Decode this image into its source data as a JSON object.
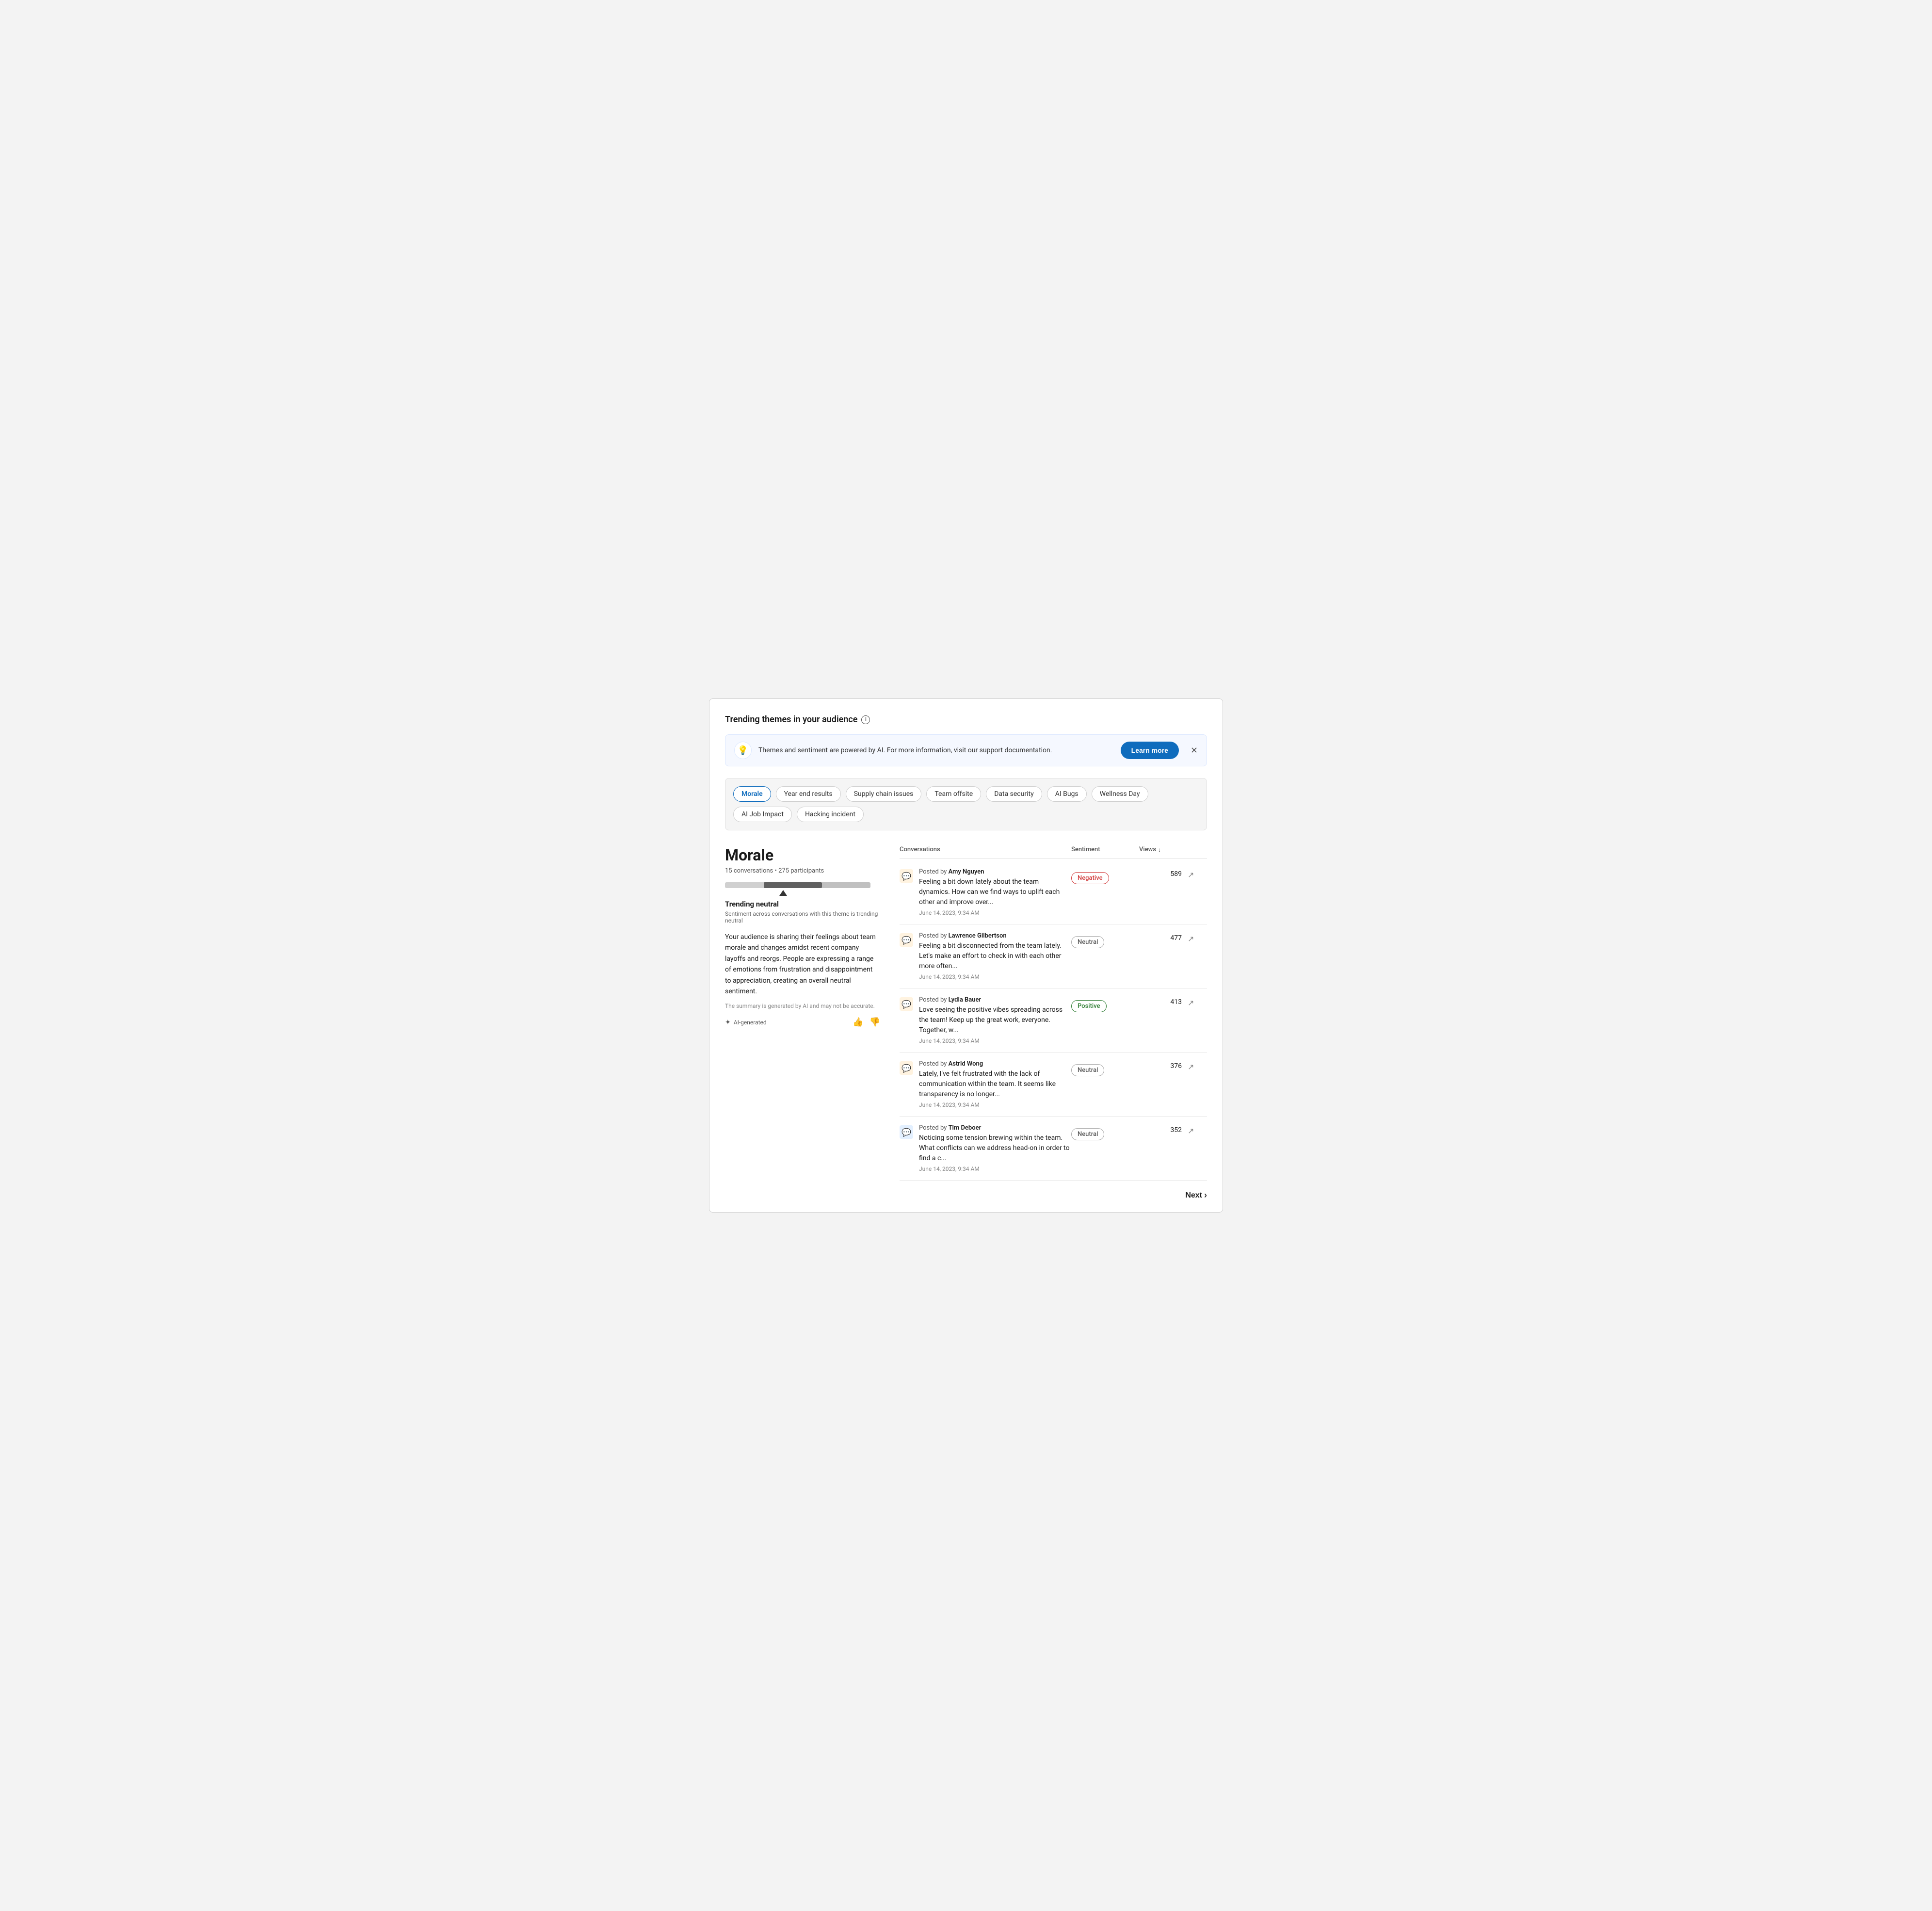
{
  "page": {
    "title": "Trending themes in your audience",
    "banner": {
      "text": "Themes and sentiment are powered by AI. For more information, visit our support documentation.",
      "learn_more": "Learn more",
      "icon": "💡"
    },
    "themes": [
      {
        "label": "Morale",
        "active": true
      },
      {
        "label": "Year end results",
        "active": false
      },
      {
        "label": "Supply chain issues",
        "active": false
      },
      {
        "label": "Team offsite",
        "active": false
      },
      {
        "label": "Data security",
        "active": false
      },
      {
        "label": "AI Bugs",
        "active": false
      },
      {
        "label": "Wellness Day",
        "active": false
      },
      {
        "label": "AI Job Impact",
        "active": false
      },
      {
        "label": "Hacking incident",
        "active": false
      }
    ],
    "left_panel": {
      "topic": "Morale",
      "conversations": "15 conversations",
      "participants": "275 participants",
      "trending_title": "Trending neutral",
      "trending_sub": "Sentiment across conversations with this theme is trending neutral",
      "summary": "Your audience is sharing their feelings about team morale and changes amidst recent company layoffs and reorgs. People are expressing a range of emotions from frustration and disappointment to appreciation, creating an overall neutral sentiment.",
      "ai_disclaimer": "The summary is generated by AI and may not be accurate.",
      "ai_label": "AI-generated"
    },
    "table": {
      "headers": {
        "conversations": "Conversations",
        "sentiment": "Sentiment",
        "views": "Views",
        "sort_arrow": "↓"
      },
      "rows": [
        {
          "author": "Amy Nguyen",
          "preview": "Feeling a bit down lately about the team dynamics. How can we find ways to uplift each other and improve over...",
          "date": "June 14, 2023, 9:34 AM",
          "sentiment": "Negative",
          "sentiment_type": "negative",
          "views": "589",
          "icon_color": "orange"
        },
        {
          "author": "Lawrence Gilbertson",
          "preview": "Feeling a bit disconnected from the team lately. Let's make an effort to check in with each other more often...",
          "date": "June 14, 2023, 9:34 AM",
          "sentiment": "Neutral",
          "sentiment_type": "neutral",
          "views": "477",
          "icon_color": "orange"
        },
        {
          "author": "Lydia Bauer",
          "preview": "Love seeing the positive vibes spreading across the team! Keep up the great work, everyone. Together, w...",
          "date": "June 14, 2023, 9:34 AM",
          "sentiment": "Positive",
          "sentiment_type": "positive",
          "views": "413",
          "icon_color": "orange"
        },
        {
          "author": "Astrid Wong",
          "preview": "Lately, I've felt frustrated with the lack of communication within the team. It seems like transparency is no longer...",
          "date": "June 14, 2023, 9:34 AM",
          "sentiment": "Neutral",
          "sentiment_type": "neutral",
          "views": "376",
          "icon_color": "orange"
        },
        {
          "author": "Tim Deboer",
          "preview": "Noticing some tension brewing within the team. What conflicts can we address head-on in order to find a c...",
          "date": "June 14, 2023, 9:34 AM",
          "sentiment": "Neutral",
          "sentiment_type": "neutral",
          "views": "352",
          "icon_color": "blue"
        }
      ]
    },
    "pagination": {
      "next_label": "Next"
    }
  }
}
